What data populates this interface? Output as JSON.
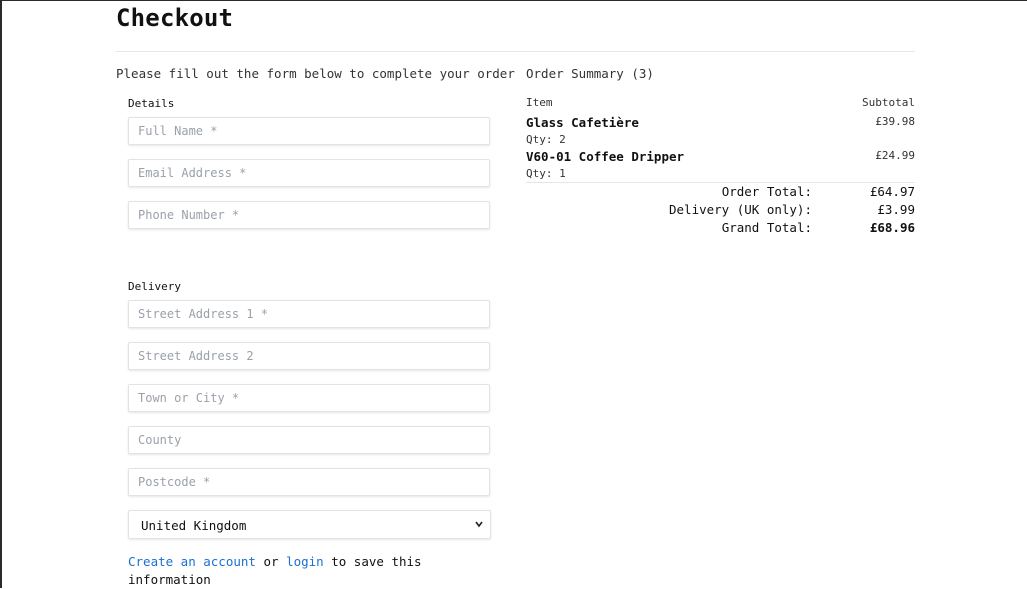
{
  "page": {
    "title": "Checkout",
    "intro": "Please fill out the form below to complete your order"
  },
  "details": {
    "label": "Details",
    "fields": {
      "full_name_placeholder": "Full Name *",
      "email_placeholder": "Email Address *",
      "phone_placeholder": "Phone Number *"
    }
  },
  "delivery": {
    "label": "Delivery",
    "fields": {
      "street1_placeholder": "Street Address 1 *",
      "street2_placeholder": "Street Address 2",
      "town_placeholder": "Town or City *",
      "county_placeholder": "County",
      "postcode_placeholder": "Postcode *"
    },
    "country_selected": "United Kingdom"
  },
  "account_prompt": {
    "create_link": "Create an account",
    "or_text": "or",
    "login_link": "login",
    "suffix": "to save this information"
  },
  "summary": {
    "title": "Order Summary (3)",
    "col_item": "Item",
    "col_subtotal": "Subtotal",
    "items": [
      {
        "name": "Glass Cafetière",
        "qty": "Qty: 2",
        "subtotal": "£39.98"
      },
      {
        "name": "V60-01 Coffee Dripper",
        "qty": "Qty: 1",
        "subtotal": "£24.99"
      }
    ],
    "totals": {
      "order_total_label": "Order Total:",
      "order_total_value": "£64.97",
      "delivery_label": "Delivery (UK only):",
      "delivery_value": "£3.99",
      "grand_total_label": "Grand Total:",
      "grand_total_value": "£68.96"
    }
  }
}
